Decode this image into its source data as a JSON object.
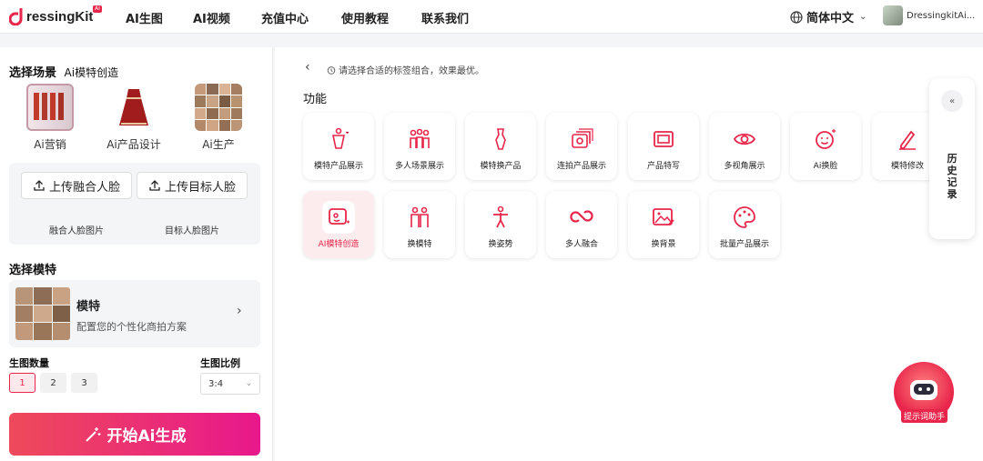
{
  "header": {
    "logo_text": "ressingKit",
    "logo_badge": "AI",
    "nav": [
      "AI生图",
      "AI视频",
      "充值中心",
      "使用教程",
      "联系我们"
    ],
    "language": "简体中文",
    "username": "DressingkitAi..."
  },
  "left_panel": {
    "scene_title": "选择场景",
    "scene_subtitle": "Ai模特创造",
    "scenes": [
      "Ai营销",
      "Ai产品设计",
      "Ai生产"
    ],
    "upload_fusion": "上传融合人脸",
    "upload_target": "上传目标人脸",
    "fusion_label": "融合人脸图片",
    "target_label": "目标人脸图片",
    "model_title": "选择模特",
    "model_name": "模特",
    "model_desc": "配置您的个性化商拍方案",
    "count_title": "生图数量",
    "counts": [
      "1",
      "2",
      "3"
    ],
    "ratio_title": "生图比例",
    "ratio_value": "3:4",
    "start_button": "开始Ai生成"
  },
  "main": {
    "hint": "请选择合适的标签组合，效果最优。",
    "func_title": "功能",
    "cards_row1": [
      "模特产品展示",
      "多人场景展示",
      "模特换产品",
      "连拍产品展示",
      "产品特写",
      "多视角展示",
      "Ai换脸",
      "模特修改"
    ],
    "cards_row2": [
      "AI模特创造",
      "换模特",
      "换姿势",
      "多人融合",
      "换背景",
      "批量产品展示"
    ],
    "active_card": "AI模特创造",
    "history_label": "历史记录",
    "history_collapse": "«",
    "assistant_label": "提示词助手"
  },
  "colors": {
    "accent": "#e8254a",
    "accent2": "#e8188c"
  }
}
